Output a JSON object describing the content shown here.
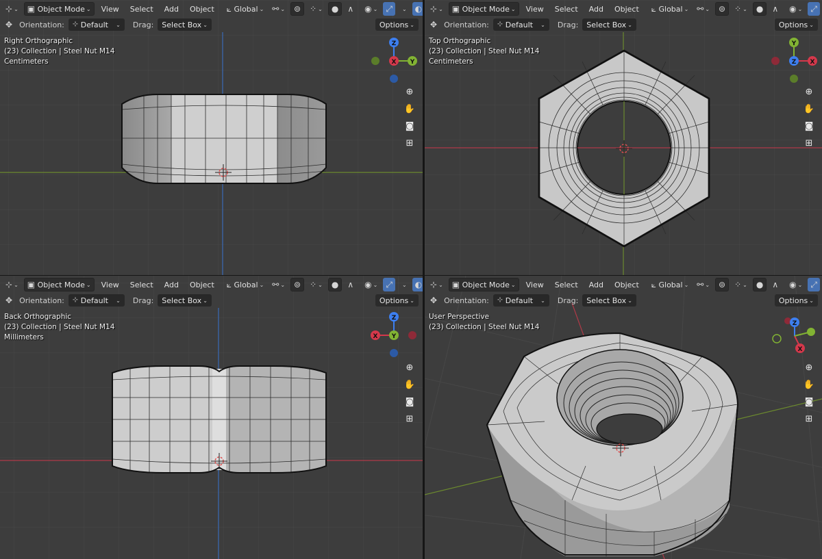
{
  "header": {
    "mode": "Object Mode",
    "menus": [
      "View",
      "Select",
      "Add",
      "Object"
    ],
    "orientation_global": "Global",
    "icons": [
      "editor-type-icon",
      "object-mode-icon",
      "transform-orientation-icon",
      "snap-icon",
      "proportional-icon",
      "visibility-icon",
      "gizmo-icon",
      "overlay-icon",
      "xray-icon"
    ]
  },
  "tool_header": {
    "orientation_label": "Orientation:",
    "orientation_value": "Default",
    "drag_label": "Drag:",
    "drag_value": "Select Box",
    "options": "Options"
  },
  "viewports": {
    "top_left": {
      "view": "Right Orthographic",
      "collection": "(23) Collection | Steel Nut M14",
      "units": "Centimeters"
    },
    "top_right": {
      "view": "Top Orthographic",
      "collection": "(23) Collection | Steel Nut M14",
      "units": "Centimeters"
    },
    "bottom_left": {
      "view": "Back Orthographic",
      "collection": "(23) Collection | Steel Nut M14",
      "units": "Millimeters"
    },
    "bottom_right": {
      "view": "User Perspective",
      "collection": "(23) Collection | Steel Nut M14"
    }
  },
  "gizmo_axes": {
    "x": "X",
    "y": "Y",
    "z": "Z"
  },
  "colors": {
    "x_axis": "#d5384b",
    "y_axis": "#82b333",
    "z_axis": "#3d7ff0",
    "viewport_bg": "#3d3d3d",
    "active_button": "#4772b3"
  }
}
